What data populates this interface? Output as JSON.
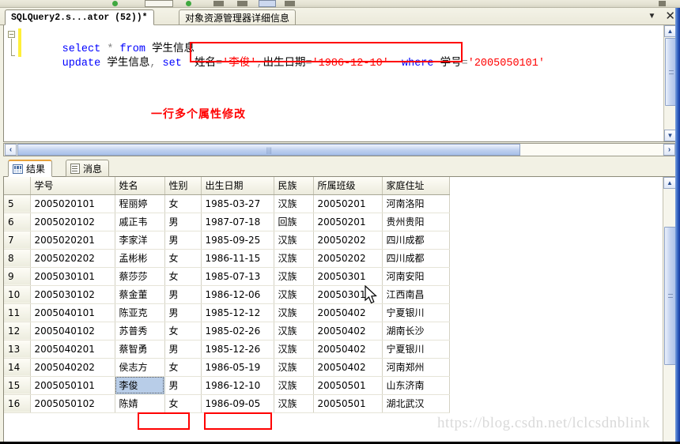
{
  "window": {
    "tabs": [
      {
        "label": "SQLQuery2.s...ator (52))*",
        "active": true
      },
      {
        "label": "对象资源管理器详细信息",
        "active": false
      }
    ],
    "caret_icon": "▼",
    "close_icon": "✕"
  },
  "editor": {
    "line1": {
      "kw_select": "select",
      "star": "*",
      "kw_from": "from",
      "table": "学生信息"
    },
    "line2": {
      "kw_update": "update",
      "table": "学生信息",
      "kw_set": "set",
      "col_name": "姓名",
      "eq1": "=",
      "val_name": "'李俊'",
      "comma": ",",
      "col_birth": "出生日期",
      "eq2": "=",
      "val_birth": "'1986-12-10'",
      "kw_where": "where",
      "col_id": "学号",
      "eq3": "=",
      "val_id": "'2005050101'"
    },
    "annotation": "一行多个属性修改",
    "highlight_color": "#ff0000"
  },
  "result_tabs": [
    {
      "label": "结果",
      "icon": "grid-icon",
      "active": true
    },
    {
      "label": "消息",
      "icon": "message-icon",
      "active": false
    }
  ],
  "grid": {
    "columns": [
      "学号",
      "姓名",
      "性别",
      "出生日期",
      "民族",
      "所属班级",
      "家庭住址"
    ],
    "rows": [
      {
        "n": "5",
        "cells": [
          "2005020101",
          "程丽婷",
          "女",
          "1985-03-27",
          "汉族",
          "20050201",
          "河南洛阳"
        ]
      },
      {
        "n": "6",
        "cells": [
          "2005020102",
          "戚正韦",
          "男",
          "1987-07-18",
          "回族",
          "20050201",
          "贵州贵阳"
        ]
      },
      {
        "n": "7",
        "cells": [
          "2005020201",
          "李家洋",
          "男",
          "1985-09-25",
          "汉族",
          "20050202",
          "四川成都"
        ]
      },
      {
        "n": "8",
        "cells": [
          "2005020202",
          "孟彬彬",
          "女",
          "1986-11-15",
          "汉族",
          "20050202",
          "四川成都"
        ]
      },
      {
        "n": "9",
        "cells": [
          "2005030101",
          "蔡莎莎",
          "女",
          "1985-07-13",
          "汉族",
          "20050301",
          "河南安阳"
        ]
      },
      {
        "n": "10",
        "cells": [
          "2005030102",
          "蔡金董",
          "男",
          "1986-12-06",
          "汉族",
          "20050301",
          "江西南昌"
        ]
      },
      {
        "n": "11",
        "cells": [
          "2005040101",
          "陈亚克",
          "男",
          "1985-12-12",
          "汉族",
          "20050402",
          "宁夏银川"
        ]
      },
      {
        "n": "12",
        "cells": [
          "2005040102",
          "苏普秀",
          "女",
          "1985-02-26",
          "汉族",
          "20050402",
          "湖南长沙"
        ]
      },
      {
        "n": "13",
        "cells": [
          "2005040201",
          "蔡智勇",
          "男",
          "1985-12-26",
          "汉族",
          "20050402",
          "宁夏银川"
        ]
      },
      {
        "n": "14",
        "cells": [
          "2005040202",
          "侯志方",
          "女",
          "1986-05-19",
          "汉族",
          "20050402",
          "河南郑州"
        ]
      },
      {
        "n": "15",
        "cells": [
          "2005050101",
          "李俊",
          "男",
          "1986-12-10",
          "汉族",
          "20050501",
          "山东济南"
        ]
      },
      {
        "n": "16",
        "cells": [
          "2005050102",
          "陈婧",
          "女",
          "1986-09-05",
          "汉族",
          "20050501",
          "湖北武汉"
        ]
      }
    ],
    "selected_row_index": 10,
    "selected_cell_column": 1,
    "selection_color": "#b8cde8"
  },
  "watermark": {
    "text": "https://blog.csdn.net/lclcsdnblink"
  },
  "scrollbar": {
    "up_arrow": "︿",
    "down_arrow": "﹀",
    "left_arrow": "‹",
    "right_arrow": "›",
    "grip": "|||"
  }
}
